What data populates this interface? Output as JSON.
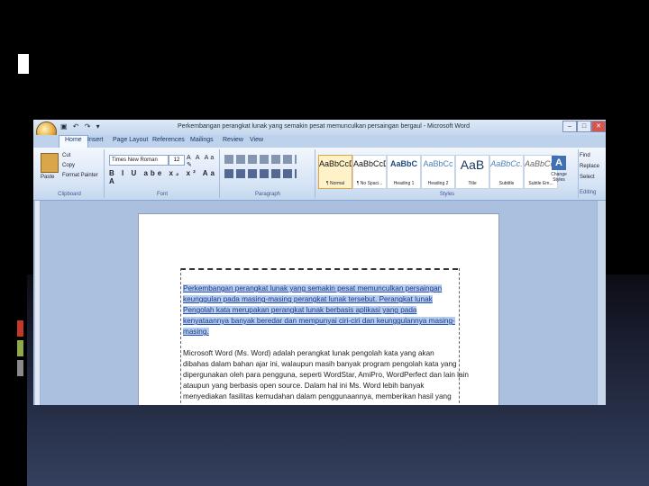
{
  "window": {
    "title": "Perkembangan perangkat lunak yang semakin pesat memunculkan persaingan bergaul - Microsoft Word",
    "minimize": "–",
    "maximize": "□",
    "close": "✕",
    "quick_access": "▣ ↶ ↷ ▾"
  },
  "tabs": [
    "Home",
    "Insert",
    "Page Layout",
    "References",
    "Mailings",
    "Review",
    "View"
  ],
  "ribbon": {
    "clipboard": {
      "paste": "Paste",
      "cut": "Cut",
      "copy": "Copy",
      "format_painter": "Format Painter",
      "label": "Clipboard"
    },
    "font": {
      "name": "Times New Roman",
      "size": "12",
      "buttons": "A  A  Aa  ✎",
      "format_row": "B I U abe x₂ x² Aa A",
      "label": "Font"
    },
    "paragraph": {
      "label": "Paragraph"
    },
    "styles": {
      "label": "Styles",
      "items": [
        {
          "preview": "AaBbCcDd",
          "name": "¶ Normal"
        },
        {
          "preview": "AaBbCcDd",
          "name": "¶ No Spaci..."
        },
        {
          "preview": "AaBbC",
          "name": "Heading 1"
        },
        {
          "preview": "AaBbCc",
          "name": "Heading 2"
        },
        {
          "preview": "AaB",
          "name": "Title"
        },
        {
          "preview": "AaBbCc.",
          "name": "Subtitle"
        },
        {
          "preview": "AaBbCcDd",
          "name": "Subtle Em..."
        }
      ],
      "change_styles": "Change Styles"
    },
    "editing": {
      "find": "Find",
      "replace": "Replace",
      "select": "Select",
      "label": "Editing"
    }
  },
  "document": {
    "lines": [
      "Perkembangan perangkat lunak yang semakin pesat memunculkan persaingan",
      "keunggulan pada masing-masing perangkat lunak tersebut. Perangkat lunak",
      "Pengolah kata merupakan perangkat lunak berbasis aplikasi yang pada",
      "kenyataannya banyak beredar dan mempunyai ciri-ciri dan keunggulannya masing-",
      "masing.",
      "",
      "Microsoft Word (Ms. Word) adalah perangkat lunak pengolah kata yang akan",
      "dibahas dalam bahan ajar ini, walaupun masih banyak program pengolah kata yang",
      "dipergunakan oleh para pengguna, seperti WordStar, AmiPro, WordPerfect dan lain lain",
      "ataupun yang berbasis open source. Dalam hal ini Ms. Word lebih banyak",
      "menyediakan fasilitas kemudahan dalam penggunaannya, memberikan hasil yang"
    ]
  },
  "colors": {
    "slide_bg": "#000000",
    "ribbon": "#d6e4f5",
    "selection": "#b6cdee",
    "accent_bar_1": "#c0392b",
    "accent_bar_2": "#8fa84a"
  }
}
